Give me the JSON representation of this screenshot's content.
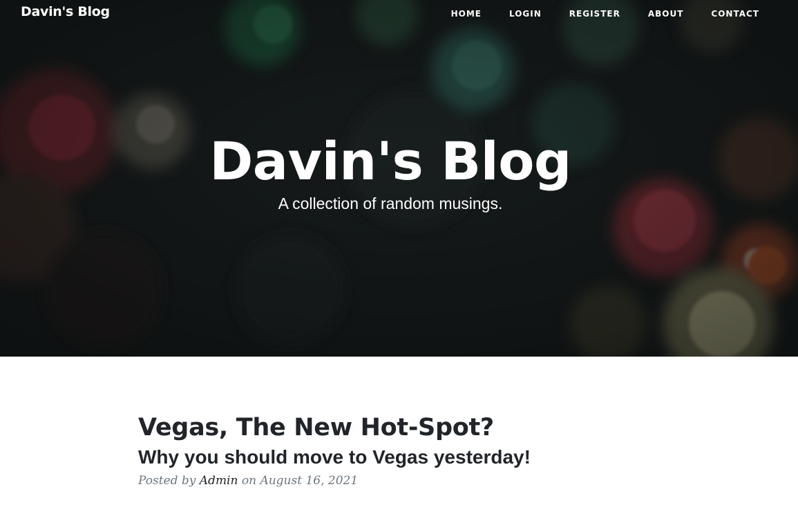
{
  "brand": "Davin's Blog",
  "nav": {
    "home": "HOME",
    "login": "LOGIN",
    "register": "REGISTER",
    "about": "ABOUT",
    "contact": "CONTACT"
  },
  "hero": {
    "heading": "Davin's Blog",
    "subheading": "A collection of random musings."
  },
  "post": {
    "title": "Vegas, The New Hot-Spot?",
    "subtitle": "Why you should move to Vegas yesterday!",
    "posted_by": "Posted by",
    "author": "Admin",
    "on": "on",
    "date": "August 16, 2021"
  },
  "colors": {
    "text_dark": "#212529",
    "meta_gray": "#6c757d",
    "header_bg": "#15191a"
  },
  "icons": {
    "header_background": "dark-floral-photo"
  }
}
